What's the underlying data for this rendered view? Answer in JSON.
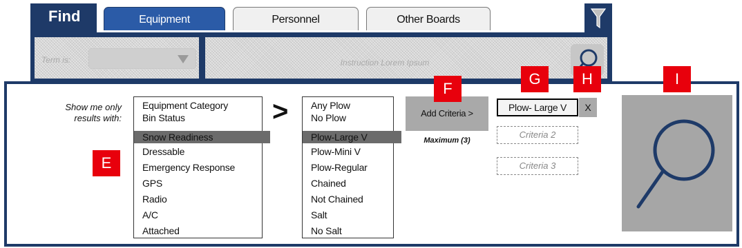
{
  "tabs": {
    "find": "Find",
    "items": [
      {
        "label": "Equipment",
        "active": true
      },
      {
        "label": "Personnel",
        "active": false
      },
      {
        "label": "Other Boards",
        "active": false
      }
    ]
  },
  "search_bar": {
    "term_label": "Term is:",
    "instruction": "Instruction Lorem Ipsum"
  },
  "filter": {
    "prompt": "Show me only results with:",
    "categories": [
      "Equipment Category",
      "Bin Status",
      "Snow Readiness",
      "Dressable",
      "Emergency Response",
      "GPS",
      "Radio",
      "A/C",
      "Attached"
    ],
    "selected_category": "Snow Readiness",
    "separator": ">",
    "values": [
      "Any Plow",
      "No Plow",
      "Plow-Large V",
      "Plow-Mini V",
      "Plow-Regular",
      "Chained",
      "Not Chained",
      "Salt",
      "No Salt"
    ],
    "selected_value": "Plow-Large V"
  },
  "criteria": {
    "add_label": "Add Criteria >",
    "maximum": "Maximum (3)",
    "selected_chip": "Plow- Large V",
    "remove": "X",
    "slot2": "Criteria 2",
    "slot3": "Criteria 3"
  },
  "markers": {
    "e": "E",
    "f": "F",
    "g": "G",
    "h": "H",
    "i": "I"
  },
  "colors": {
    "navy": "#1e3a68",
    "accent_blue": "#2b5ba7",
    "marker_red": "#e8000c",
    "selected_gray": "#6b6b6b"
  }
}
